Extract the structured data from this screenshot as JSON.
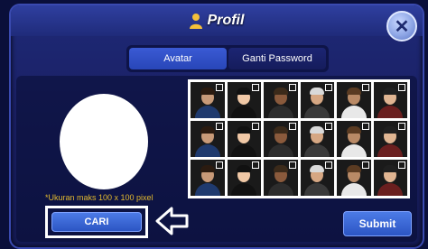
{
  "window": {
    "title": "Profil",
    "title_icon": "user-icon",
    "close_icon": "close-icon",
    "close_glyph": "✕"
  },
  "tabs": [
    {
      "label": "Avatar",
      "active": true
    },
    {
      "label": "Ganti Password",
      "active": false
    }
  ],
  "upload": {
    "note": "*Ukuran maks 100 x 100 pixel",
    "search_label": "CARI"
  },
  "avatars": {
    "count": 18,
    "columns": 6,
    "rows": 3
  },
  "footer": {
    "submit_label": "Submit"
  },
  "colors": {
    "background": "#0a0f3a",
    "panel": "#1e2a78",
    "accent_button": "#2c55c4",
    "note_text": "#e2b92f"
  }
}
